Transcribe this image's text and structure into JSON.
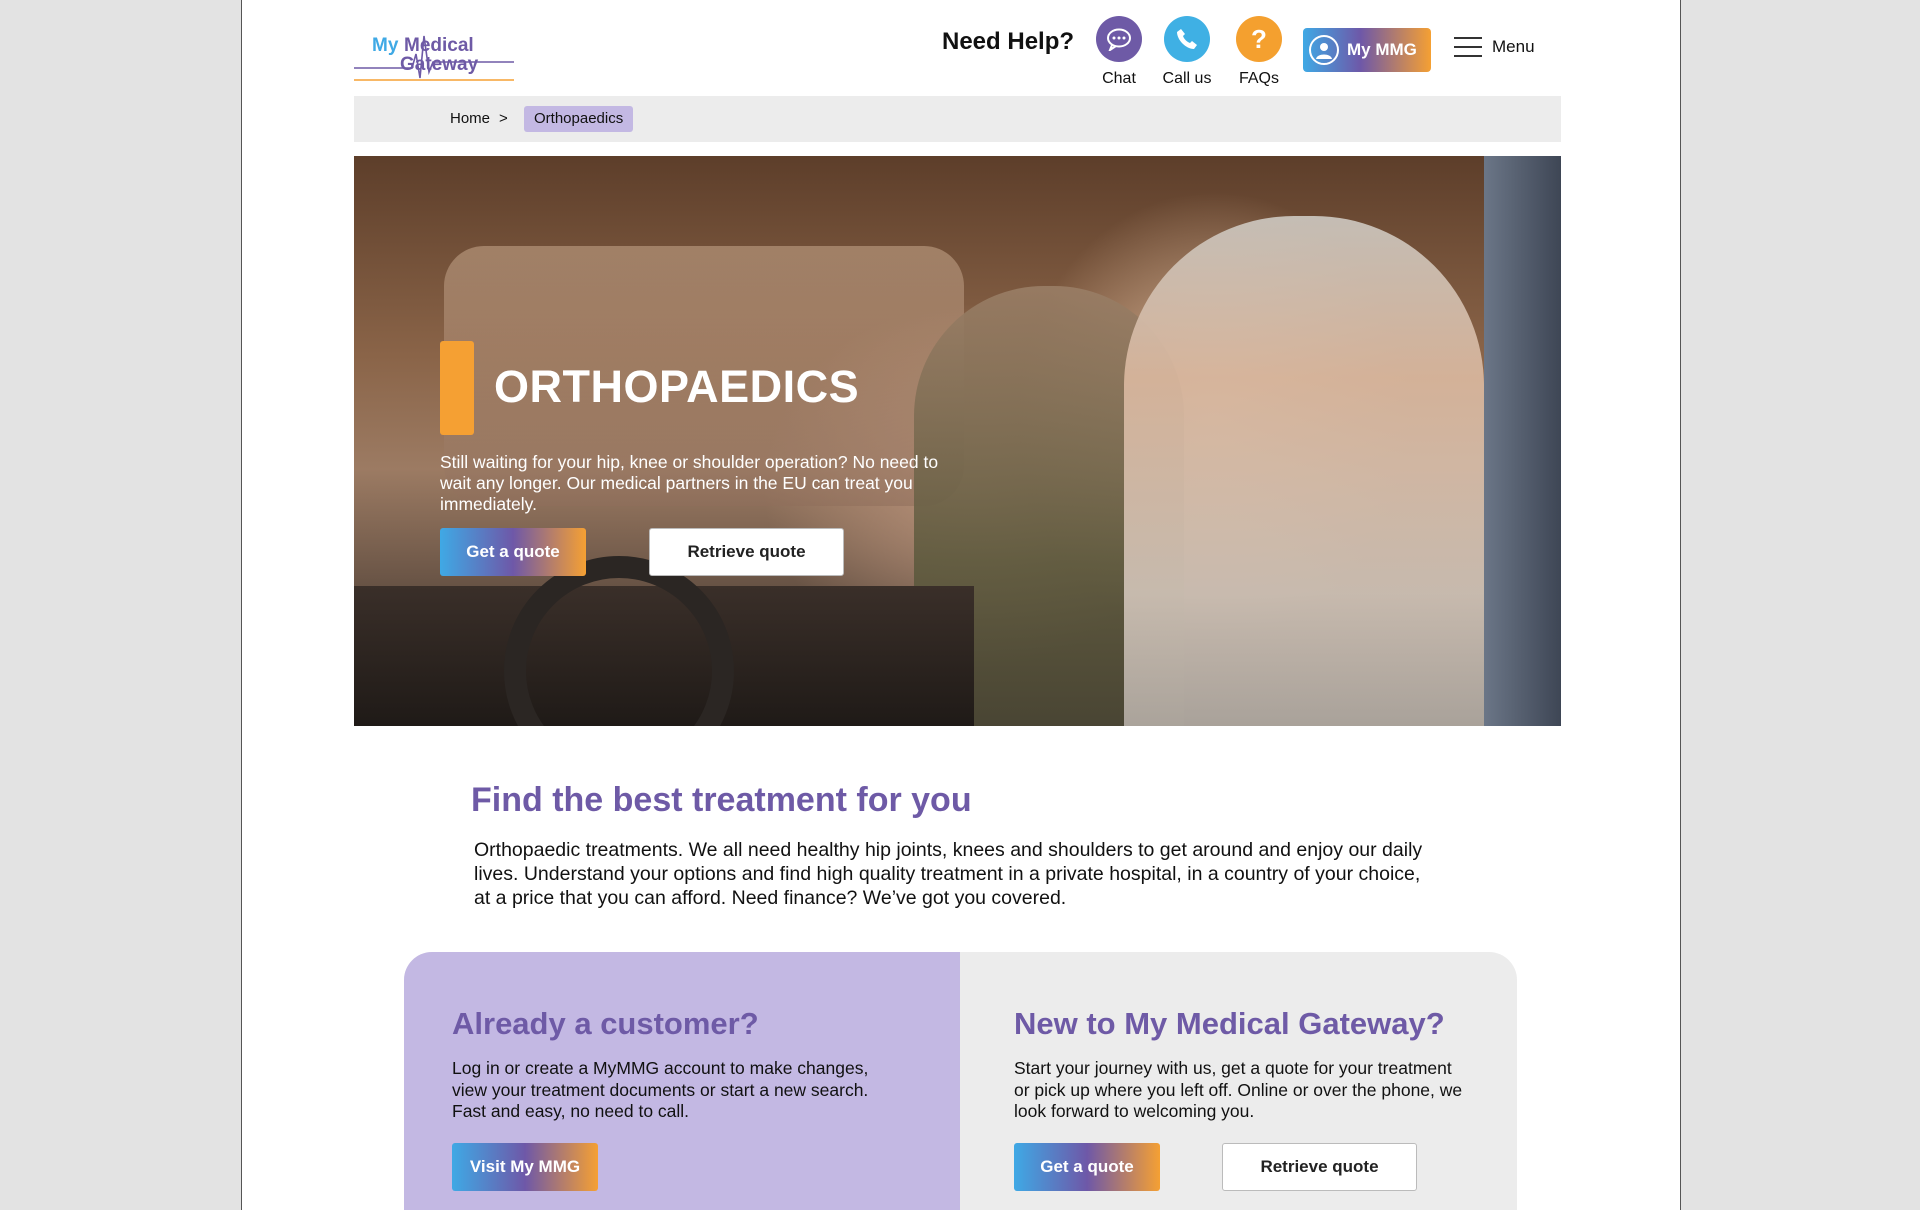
{
  "logo": {
    "line1": "My Medical",
    "line2": "Gateway"
  },
  "header": {
    "need_help": "Need Help?",
    "chat_label": "Chat",
    "call_label": "Call us",
    "faq_label": "FAQs",
    "faq_glyph": "?",
    "mymmg_label": "My MMG",
    "menu_label": "Menu"
  },
  "breadcrumb": {
    "home": "Home",
    "separator": ">",
    "current": "Orthopaedics"
  },
  "hero": {
    "title": "ORTHOPAEDICS",
    "text": "Still waiting for your hip, knee or shoulder operation? No need to wait any longer. Our medical partners in the EU can treat you immediately.",
    "get_quote": "Get a quote",
    "retrieve_quote": "Retrieve quote"
  },
  "find": {
    "title": "Find the best treatment for you",
    "text": "Orthopaedic treatments. We all need healthy hip joints, knees and shoulders to get around and enjoy our daily lives. Understand your options and find high quality treatment in a private hospital, in a country of your choice, at a price that you can afford.  Need finance?  We’ve got you covered."
  },
  "existing_customer": {
    "title": "Already a customer?",
    "text": "Log in or create a MyMMG account to make changes, view your treatment documents or start a new search. Fast and easy, no need to call.",
    "button": "Visit My MMG"
  },
  "new_customer": {
    "title": "New to My Medical Gateway?",
    "text": "Start your journey with us, get a quote for your treatment or pick up where you left off. Online or over the phone, we look forward to welcoming you.",
    "get_quote": "Get a quote",
    "retrieve_quote": "Retrieve quote"
  },
  "colors": {
    "brand_purple": "#6e5aa6",
    "brand_blue": "#3fa9e5",
    "brand_orange": "#f5a033",
    "lavender": "#c3b8e3"
  }
}
